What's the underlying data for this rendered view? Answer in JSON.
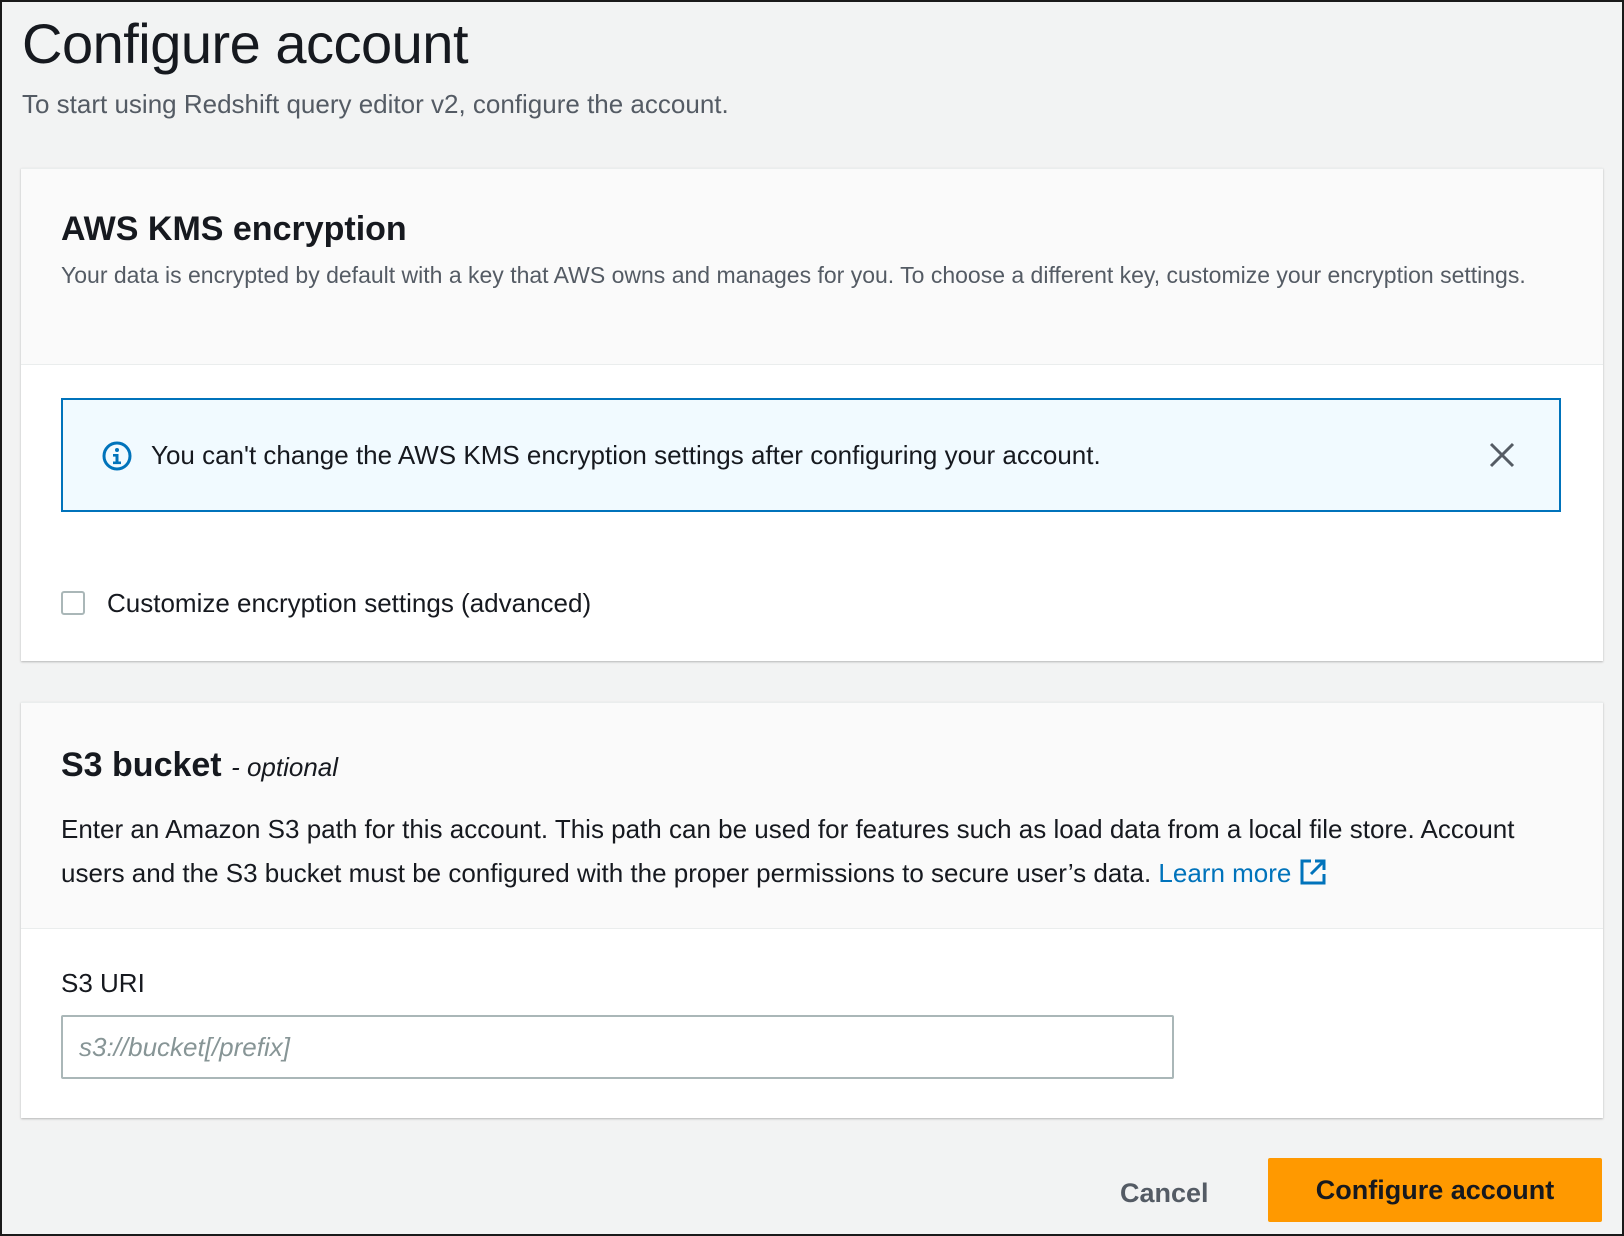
{
  "page": {
    "title": "Configure account",
    "subtitle": "To start using Redshift query editor v2, configure the account."
  },
  "kms": {
    "title": "AWS KMS encryption",
    "description": "Your data is encrypted by default with a key that AWS owns and manages for you. To choose a different key, customize your encryption settings.",
    "alert": {
      "icon": "info-icon",
      "text": "You can't change the AWS KMS encryption settings after configuring your account.",
      "close_icon": "close-icon"
    },
    "checkbox": {
      "label": "Customize encryption settings (advanced)",
      "checked": false
    }
  },
  "s3": {
    "title": "S3 bucket",
    "optional_label": "- optional",
    "description": "Enter an Amazon S3 path for this account. This path can be used for features such as load data from a local file store. Account users and the S3 bucket must be configured with the proper permissions to secure user’s data.",
    "learn_more": "Learn more",
    "learn_more_icon": "external-link-icon",
    "field_label": "S3 URI",
    "input_value": "",
    "input_placeholder": "s3://bucket[/prefix]"
  },
  "footer": {
    "cancel_label": "Cancel",
    "configure_label": "Configure account"
  },
  "colors": {
    "primary_button": "#ff9900",
    "info_border": "#0073bb",
    "info_background": "#f1faff",
    "link": "#0073bb",
    "page_background": "#f2f3f3"
  }
}
